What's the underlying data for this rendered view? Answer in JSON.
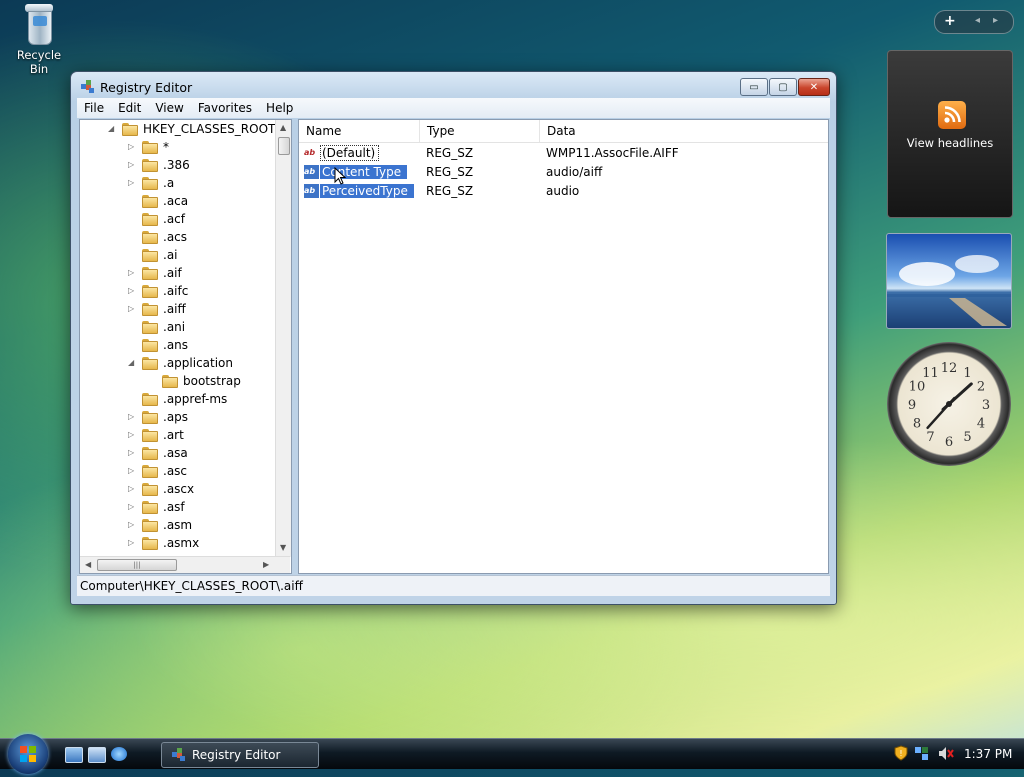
{
  "desktop": {
    "recycle_bin_label": "Recycle Bin"
  },
  "window": {
    "title": "Registry Editor",
    "buttons": {
      "minimize": "▭",
      "maximize": "▢",
      "close": "✕"
    },
    "menu": [
      "File",
      "Edit",
      "View",
      "Favorites",
      "Help"
    ]
  },
  "tree": {
    "root": "HKEY_CLASSES_ROOT",
    "items": [
      "*",
      ".386",
      ".a",
      ".aca",
      ".acf",
      ".acs",
      ".ai",
      ".aif",
      ".aifc",
      ".aiff",
      ".ani",
      ".ans",
      ".application",
      "bootstrap",
      ".appref-ms",
      ".aps",
      ".art",
      ".asa",
      ".asc",
      ".ascx",
      ".asf",
      ".asm",
      ".asmx"
    ]
  },
  "list": {
    "columns": [
      "Name",
      "Type",
      "Data"
    ],
    "rows": [
      {
        "name": "(Default)",
        "type": "REG_SZ",
        "data": "WMP11.AssocFile.AIFF"
      },
      {
        "name": "Content Type",
        "type": "REG_SZ",
        "data": "audio/aiff"
      },
      {
        "name": "PerceivedType",
        "type": "REG_SZ",
        "data": "audio"
      }
    ]
  },
  "statusbar": {
    "path": "Computer\\HKEY_CLASSES_ROOT\\.aiff"
  },
  "gadgets": {
    "controls": {
      "add": "+",
      "prev": "◂",
      "next": "▸"
    },
    "rss_label": "View headlines",
    "clock_numbers": [
      "12",
      "1",
      "2",
      "3",
      "4",
      "5",
      "6",
      "7",
      "8",
      "9",
      "10",
      "11"
    ]
  },
  "taskbar": {
    "task_label": "Registry Editor",
    "time": "1:37 PM"
  }
}
